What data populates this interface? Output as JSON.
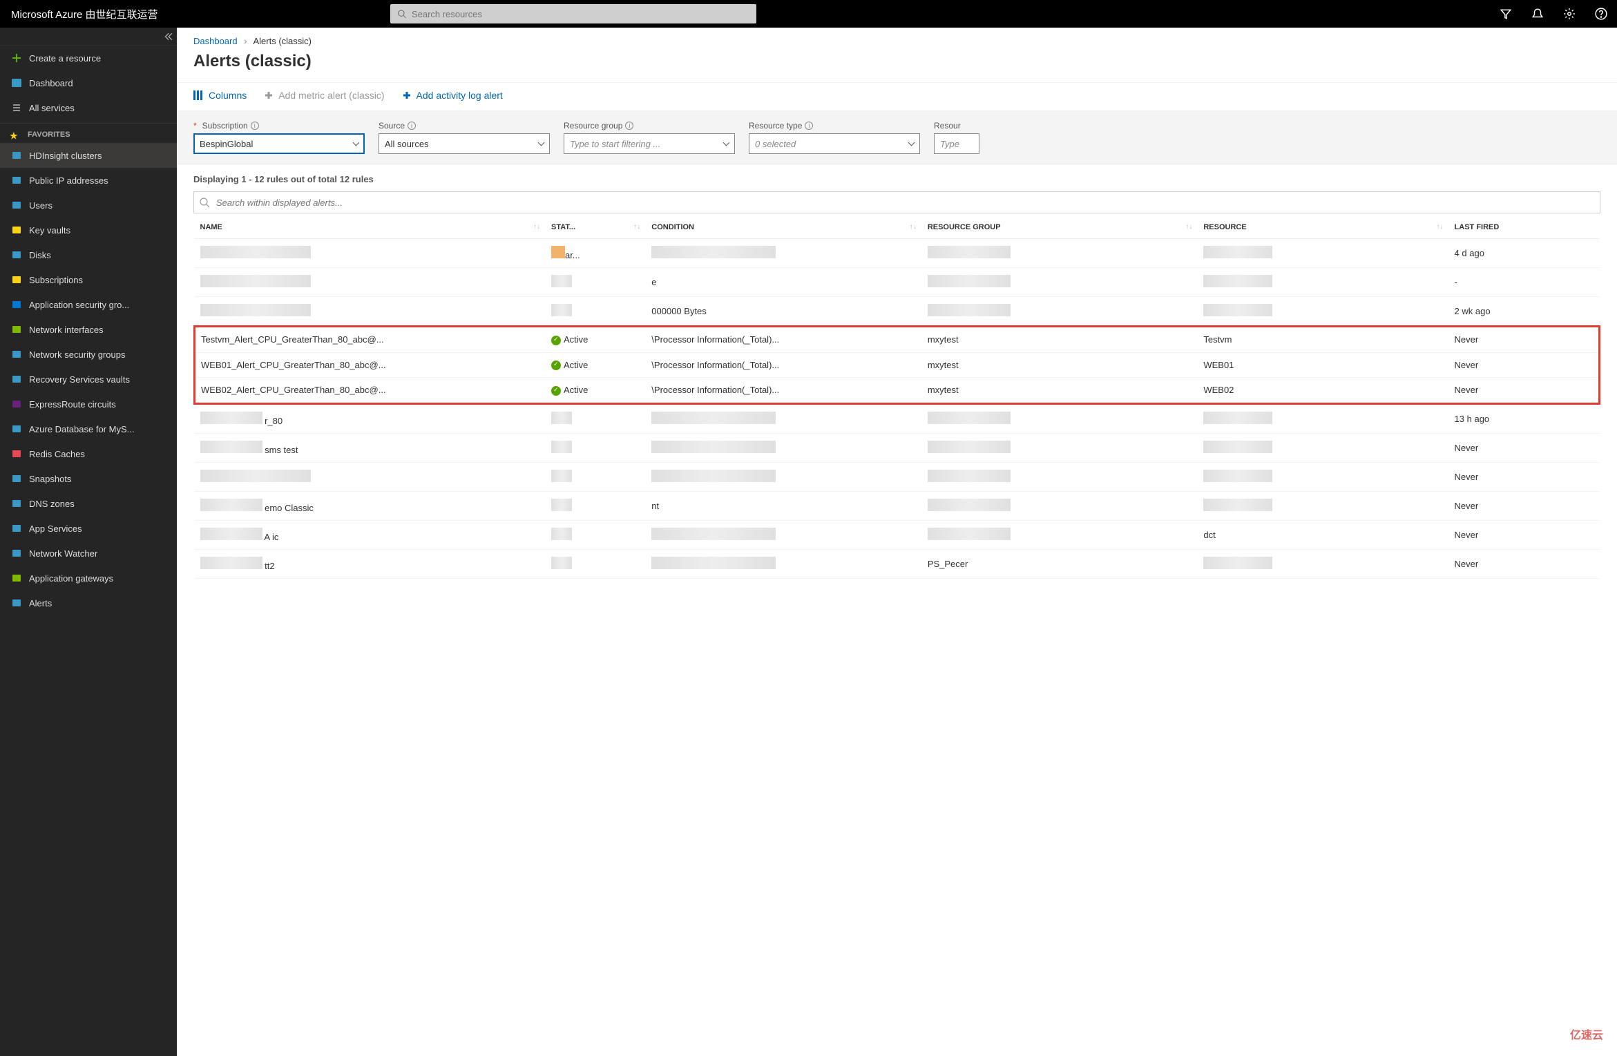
{
  "topbar": {
    "brand": "Microsoft Azure 由世纪互联运营",
    "search_placeholder": "Search resources"
  },
  "sidebar": {
    "create": "Create a resource",
    "dashboard": "Dashboard",
    "all_services": "All services",
    "fav_header": "FAVORITES",
    "items": [
      "HDInsight clusters",
      "Public IP addresses",
      "Users",
      "Key vaults",
      "Disks",
      "Subscriptions",
      "Application security gro...",
      "Network interfaces",
      "Network security groups",
      "Recovery Services vaults",
      "ExpressRoute circuits",
      "Azure Database for MyS...",
      "Redis Caches",
      "Snapshots",
      "DNS zones",
      "App Services",
      "Network Watcher",
      "Application gateways",
      "Alerts"
    ]
  },
  "breadcrumb": {
    "root": "Dashboard",
    "current": "Alerts (classic)"
  },
  "page_title": "Alerts (classic)",
  "toolbar": {
    "columns": "Columns",
    "add_metric": "Add metric alert (classic)",
    "add_activity": "Add activity log alert"
  },
  "filters": {
    "subscription_label": "Subscription",
    "subscription_value": "BespinGlobal",
    "source_label": "Source",
    "source_value": "All sources",
    "rg_label": "Resource group",
    "rg_placeholder": "Type to start filtering ...",
    "rtype_label": "Resource type",
    "rtype_value": "0 selected",
    "resource_label": "Resour",
    "resource_placeholder": "Type"
  },
  "results": {
    "count_text": "Displaying 1 - 12 rules out of total 12 rules",
    "search_placeholder": "Search within displayed alerts..."
  },
  "columns": {
    "name": "NAME",
    "status": "STAT...",
    "condition": "CONDITION",
    "rg": "RESOURCE GROUP",
    "resource": "RESOURCE",
    "last": "LAST FIRED"
  },
  "rows": [
    {
      "name": "",
      "status": "ar...",
      "cond": "",
      "rg": "",
      "res": "",
      "last": "4 d ago",
      "redacted": true
    },
    {
      "name": "",
      "status": "",
      "cond": "e",
      "rg": "",
      "res": "",
      "last": "-",
      "redacted": true
    },
    {
      "name": "",
      "status": "",
      "cond": "000000 Bytes",
      "rg": "",
      "res": "",
      "last": "2 wk ago",
      "redacted": true
    },
    {
      "name": "Testvm_Alert_CPU_GreaterThan_80_abc@...",
      "status": "Active",
      "cond": "\\Processor Information(_Total)...",
      "rg": "mxytest",
      "res": "Testvm",
      "last": "Never",
      "hl": true
    },
    {
      "name": "WEB01_Alert_CPU_GreaterThan_80_abc@...",
      "status": "Active",
      "cond": "\\Processor Information(_Total)...",
      "rg": "mxytest",
      "res": "WEB01",
      "last": "Never",
      "hl": true
    },
    {
      "name": "WEB02_Alert_CPU_GreaterThan_80_abc@...",
      "status": "Active",
      "cond": "\\Processor Information(_Total)...",
      "rg": "mxytest",
      "res": "WEB02",
      "last": "Never",
      "hl": true
    },
    {
      "name": "r_80",
      "status": "",
      "cond": "",
      "rg": "",
      "res": "",
      "last": "13 h ago",
      "redacted": true,
      "partial": true
    },
    {
      "name": "sms test",
      "status": "",
      "cond": "",
      "rg": "",
      "res": "",
      "last": "Never",
      "redacted": true,
      "partial": true
    },
    {
      "name": "",
      "status": "",
      "cond": "",
      "rg": "",
      "res": "",
      "last": "Never",
      "redacted": true
    },
    {
      "name": "emo Classic",
      "status": "",
      "cond": "nt",
      "rg": "",
      "res": "",
      "last": "Never",
      "redacted": true,
      "partial": true
    },
    {
      "name": "A                              ic",
      "status": "",
      "cond": "",
      "rg": "",
      "res": "dct",
      "last": "Never",
      "redacted": true,
      "partial": true
    },
    {
      "name": "tt2",
      "status": "",
      "cond": "",
      "rg": "PS_Pecer",
      "res": "",
      "last": "Never",
      "redacted": true,
      "partial": true
    }
  ],
  "watermark": "亿速云"
}
